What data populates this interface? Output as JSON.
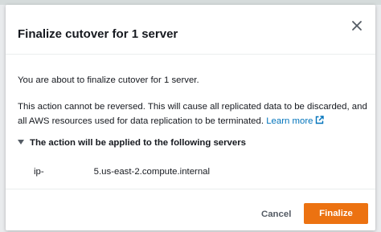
{
  "modal": {
    "title": "Finalize cutover for 1 server",
    "close_icon": "close-icon",
    "intro": "You are about to finalize cutover for 1 server.",
    "warning": "This action cannot be reversed. This will cause all replicated data to be discarded, and all AWS resources used for data replication to be terminated.",
    "learn_more_label": "Learn more",
    "external_link_icon": "external-link-icon",
    "expander_label": "The action will be applied to the following servers",
    "expander_icon": "caret-down-icon",
    "servers": [
      {
        "name_prefix": "ip-",
        "name_suffix": "5.us-east-2.compute.internal"
      }
    ]
  },
  "footer": {
    "cancel_label": "Cancel",
    "finalize_label": "Finalize"
  },
  "colors": {
    "primary_button": "#ec7211",
    "link": "#0073bb",
    "text": "#16191f",
    "muted_text": "#545b64"
  }
}
